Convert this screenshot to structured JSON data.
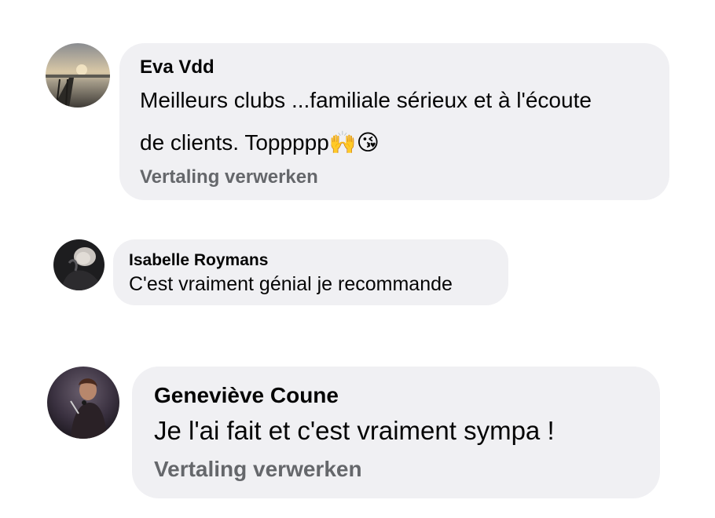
{
  "comments": [
    {
      "author": "Eva Vdd",
      "text_line1": "Meilleurs clubs ...familiale sérieux et à l'écoute",
      "text_line2": "de clients. Toppppp",
      "emoji": "🙌😘",
      "translate_label": "Vertaling verwerken"
    },
    {
      "author": "Isabelle Roymans",
      "text": "C'est vraiment génial je recommande"
    },
    {
      "author": "Geneviève Coune",
      "text": "Je l'ai fait et c'est vraiment sympa !",
      "translate_label": "Vertaling verwerken"
    }
  ],
  "colors": {
    "bubble_bg": "#f0f0f3",
    "name_text": "#050505",
    "translate_text": "#65676b"
  }
}
